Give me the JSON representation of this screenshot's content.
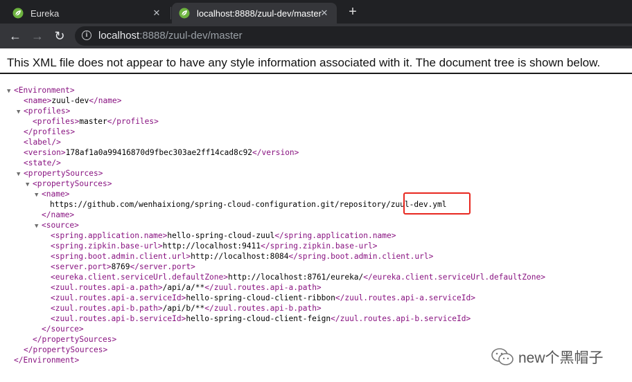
{
  "browser": {
    "tabs": [
      {
        "title": "Eureka",
        "close": "✕"
      },
      {
        "title": "localhost:8888/zuul-dev/master",
        "close": "✕"
      }
    ],
    "new_tab": "+",
    "nav": {
      "back": "←",
      "forward": "→",
      "reload": "↻"
    },
    "address": {
      "host": "localhost",
      "rest": ":8888/zuul-dev/master"
    }
  },
  "page": {
    "banner": "This XML file does not appear to have any style information associated with it. The document tree is shown below."
  },
  "xml": {
    "env_open": "<Environment>",
    "env_close": "</Environment>",
    "name_open": "<name>",
    "name_val": "zuul-dev",
    "name_close": "</name>",
    "profiles_open": "<profiles>",
    "profiles_inner_open": "<profiles>",
    "profiles_val": "master",
    "profiles_inner_close": "</profiles>",
    "profiles_close": "</profiles>",
    "label": "<label/>",
    "version_open": "<version>",
    "version_val": "178af1a0a99416870d9fbec303ae2ff14cad8c92",
    "version_close": "</version>",
    "state": "<state/>",
    "ps_open": "<propertySources>",
    "ps_inner_open": "<propertySources>",
    "ps_name_open": "<name>",
    "ps_name_val_a": "https://github.com/wenhaixiong/spring-cloud-configuration.git/repository/",
    "ps_name_val_b": "zuul-dev.yml",
    "ps_name_close": "</name>",
    "source_open": "<source>",
    "source_close": "</source>",
    "ps_inner_close": "</propertySources>",
    "ps_close": "</propertySources>",
    "props": [
      {
        "open": "<spring.application.name>",
        "val": "hello-spring-cloud-zuul",
        "close": "</spring.application.name>"
      },
      {
        "open": "<spring.zipkin.base-url>",
        "val": "http://localhost:9411",
        "close": "</spring.zipkin.base-url>"
      },
      {
        "open": "<spring.boot.admin.client.url>",
        "val": "http://localhost:8084",
        "close": "</spring.boot.admin.client.url>"
      },
      {
        "open": "<server.port>",
        "val": "8769",
        "close": "</server.port>"
      },
      {
        "open": "<eureka.client.serviceUrl.defaultZone>",
        "val": "http://localhost:8761/eureka/",
        "close": "</eureka.client.serviceUrl.defaultZone>"
      },
      {
        "open": "<zuul.routes.api-a.path>",
        "val": "/api/a/**",
        "close": "</zuul.routes.api-a.path>"
      },
      {
        "open": "<zuul.routes.api-a.serviceId>",
        "val": "hello-spring-cloud-client-ribbon",
        "close": "</zuul.routes.api-a.serviceId>"
      },
      {
        "open": "<zuul.routes.api-b.path>",
        "val": "/api/b/**",
        "close": "</zuul.routes.api-b.path>"
      },
      {
        "open": "<zuul.routes.api-b.serviceId>",
        "val": "hello-spring-cloud-client-feign",
        "close": "</zuul.routes.api-b.serviceId>"
      }
    ]
  },
  "watermark": {
    "text": "new个黑帽子"
  },
  "colors": {
    "tag": "#881280",
    "highlight": "#e8271f",
    "tabbar": "#202124"
  }
}
